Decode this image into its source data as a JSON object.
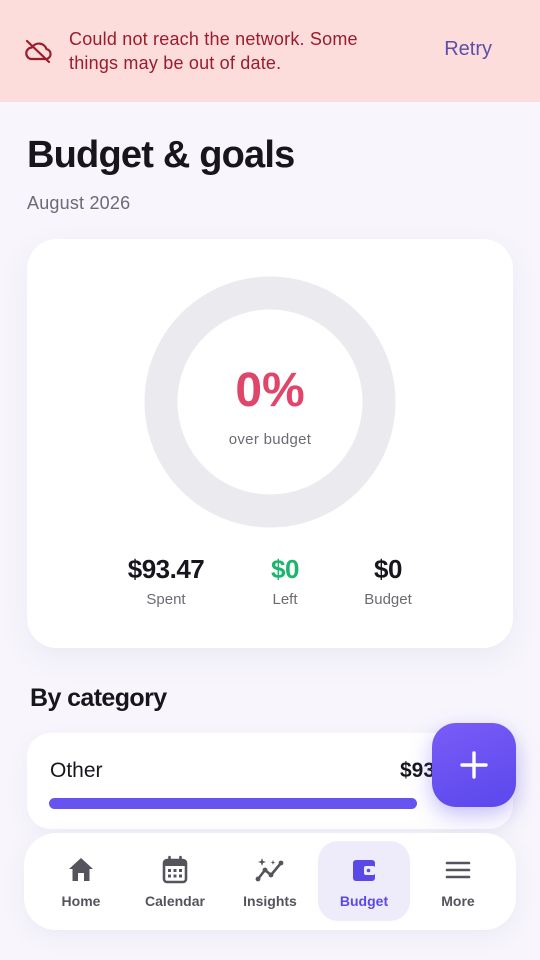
{
  "banner": {
    "message": "Could not reach the network. Some things may be out of date.",
    "retry_label": "Retry",
    "icon": "cloud-off-icon"
  },
  "header": {
    "title": "Budget & goals",
    "subtitle": "August 2026"
  },
  "summary": {
    "percent_text": "0%",
    "percent_caption": "over budget",
    "ring_progress": 0,
    "stats": [
      {
        "value": "$93.47",
        "label": "Spent"
      },
      {
        "value": "$0",
        "label": "Left"
      },
      {
        "value": "$0",
        "label": "Budget"
      }
    ]
  },
  "categories": {
    "title": "By category",
    "items": [
      {
        "name": "Other",
        "amount": "$93",
        "progress": 1.0
      }
    ]
  },
  "fab": {
    "icon": "plus-icon"
  },
  "nav": {
    "items": [
      {
        "label": "Home",
        "icon": "home-icon",
        "active": false
      },
      {
        "label": "Calendar",
        "icon": "calendar-icon",
        "active": false
      },
      {
        "label": "Insights",
        "icon": "insights-icon",
        "active": false
      },
      {
        "label": "Budget",
        "icon": "wallet-icon",
        "active": true
      },
      {
        "label": "More",
        "icon": "menu-icon",
        "active": false
      }
    ]
  },
  "colors": {
    "accent": "#6653F0",
    "banner_bg": "#FDDCDC",
    "banner_text": "#9B1C2A",
    "danger": "#E0466A",
    "positive": "#1CB56F"
  }
}
